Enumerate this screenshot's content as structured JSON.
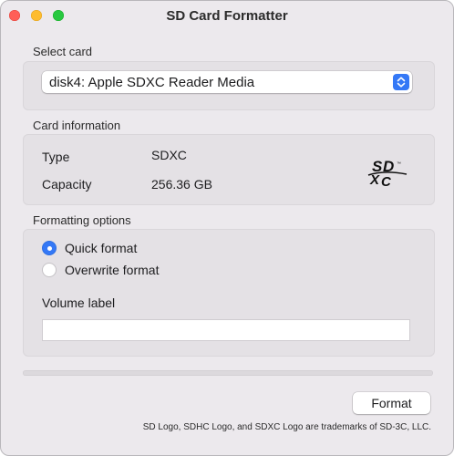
{
  "window": {
    "title": "SD Card Formatter"
  },
  "select_card": {
    "label": "Select card",
    "selected": "disk4: Apple SDXC Reader Media",
    "stepper_icon": "up-down-chevron-icon"
  },
  "card_information": {
    "label": "Card information",
    "type_label": "Type",
    "type_value": "SDXC",
    "capacity_label": "Capacity",
    "capacity_value": "256.36 GB",
    "logo_text": "SDXC"
  },
  "formatting_options": {
    "label": "Formatting options",
    "quick_format": "Quick format",
    "overwrite_format": "Overwrite format",
    "selected_option": "Quick format",
    "volume_label": "Volume label",
    "volume_value": ""
  },
  "progress": {
    "fraction": 0
  },
  "actions": {
    "format_label": "Format"
  },
  "footer": {
    "text": "SD Logo, SDHC Logo, and SDXC Logo are trademarks of SD-3C, LLC."
  },
  "colors": {
    "accent": "#3478f6",
    "window_bg": "#ece9ed",
    "group_bg": "#e4e1e5"
  }
}
